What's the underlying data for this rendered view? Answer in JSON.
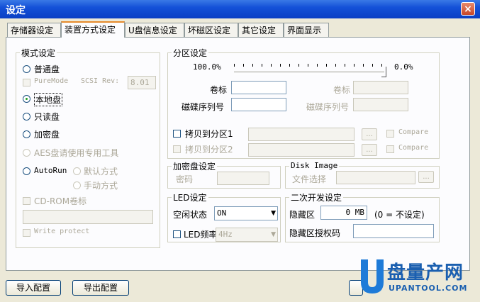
{
  "window": {
    "title": "设定",
    "close": "×"
  },
  "tabs": [
    "存储器设定",
    "装置方式设定",
    "U盘信息设定",
    "坏磁区设定",
    "其它设定",
    "界面显示"
  ],
  "mode": {
    "title": "模式设定",
    "normal": "普通盘",
    "puremode": "PureMode",
    "scsi_rev": "SCSI Rev:",
    "scsi_val": "8.01",
    "local": "本地盘",
    "readonly": "只读盘",
    "encrypt": "加密盘",
    "aes": "AES盘请使用专用工具",
    "autorun": "AutoRun",
    "default": "默认方式",
    "manual": "手动方式",
    "cdrom": "CD-ROM卷标",
    "writeprotect": "Write protect"
  },
  "partition": {
    "title": "分区设定",
    "left_pct": "100.0%",
    "right_pct": "0.0%",
    "slider_level": 100,
    "label": "卷标",
    "label2": "卷标",
    "serial": "磁碟序列号",
    "serial2": "磁碟序列号",
    "copy1": "拷贝到分区1",
    "copy2": "拷贝到分区2",
    "browse": "...",
    "compare": "Compare"
  },
  "encdisk": {
    "title": "加密盘设定",
    "password": "密码"
  },
  "diskimage": {
    "title": "Disk Image",
    "file": "文件选择",
    "browse": "..."
  },
  "led": {
    "title": "LED设定",
    "idle": "空闲状态",
    "idle_val": "ON",
    "freq": "LED频率",
    "freq_val": "4Hz"
  },
  "dev": {
    "title": "二次开发设定",
    "hidden": "隐藏区",
    "hidden_val": "0 MB",
    "hidden_note": "(0 = 不设定)",
    "auth": "隐藏区授权码"
  },
  "buttons": {
    "import": "导入配置",
    "export": "导出配置"
  },
  "watermark": {
    "text": "盘量产网",
    "url": "UPANTOOL.COM",
    "colors": {
      "u": "#1e7bd8",
      "text": "#1a5fb0"
    }
  },
  "colors": {
    "titlebar": "#1451d8",
    "face": "#ece9d8",
    "tab_highlight": "#e68b2c"
  }
}
